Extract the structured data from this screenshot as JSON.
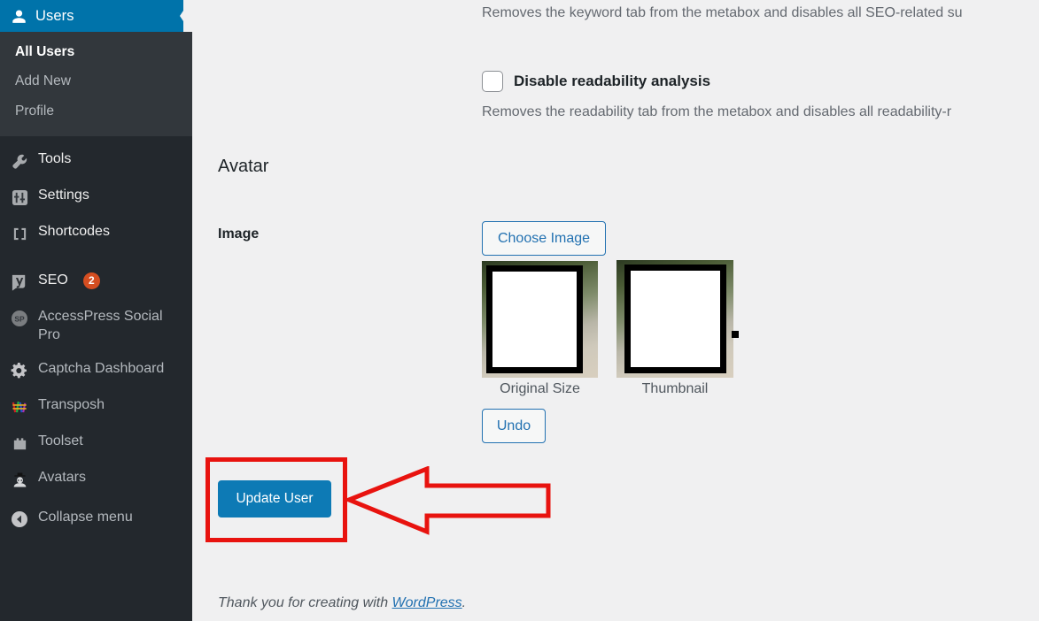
{
  "sidebar": {
    "header": {
      "label": "Users",
      "icon": "user-icon",
      "accent": "#0073aa"
    },
    "submenu": [
      {
        "label": "All Users",
        "current": true
      },
      {
        "label": "Add New",
        "current": false
      },
      {
        "label": "Profile",
        "current": false
      }
    ],
    "items": [
      {
        "label": "Tools",
        "icon": "wrench-icon",
        "badge": ""
      },
      {
        "label": "Settings",
        "icon": "sliders-icon",
        "badge": ""
      },
      {
        "label": "Shortcodes",
        "icon": "brackets-icon",
        "badge": ""
      },
      {
        "label": "SEO",
        "icon": "yoast-icon",
        "badge": "2"
      },
      {
        "label": "AccessPress Social Pro",
        "icon": "sp-icon",
        "badge": ""
      },
      {
        "label": "Captcha Dashboard",
        "icon": "gear-icon",
        "badge": ""
      },
      {
        "label": "Transposh",
        "icon": "transposh-icon",
        "badge": ""
      },
      {
        "label": "Toolset",
        "icon": "toolset-icon",
        "badge": ""
      },
      {
        "label": "Avatars",
        "icon": "avatar-hat-icon",
        "badge": ""
      }
    ],
    "collapse": {
      "label": "Collapse menu",
      "icon": "collapse-arrow-icon"
    },
    "badge_color": "#d54e21"
  },
  "main": {
    "keyword_desc": "Removes the keyword tab from the metabox and disables all SEO-related su",
    "readability_checkbox": {
      "label": "Disable readability analysis",
      "checked": false
    },
    "readability_desc": "Removes the readability tab from the metabox and disables all readability-r",
    "avatar_section_title": "Avatar",
    "image_field_label": "Image",
    "choose_image_label": "Choose Image",
    "undo_label": "Undo",
    "previews": [
      {
        "caption": "Original Size"
      },
      {
        "caption": "Thumbnail"
      }
    ],
    "update_user_label": "Update User",
    "footer": {
      "prefix": "Thank you for creating with ",
      "link": "WordPress",
      "suffix": "."
    }
  },
  "annotations": {
    "highlight_color": "#e8130f",
    "shapes": [
      "rectangle-around-update-user",
      "left-pointing-arrow"
    ]
  }
}
